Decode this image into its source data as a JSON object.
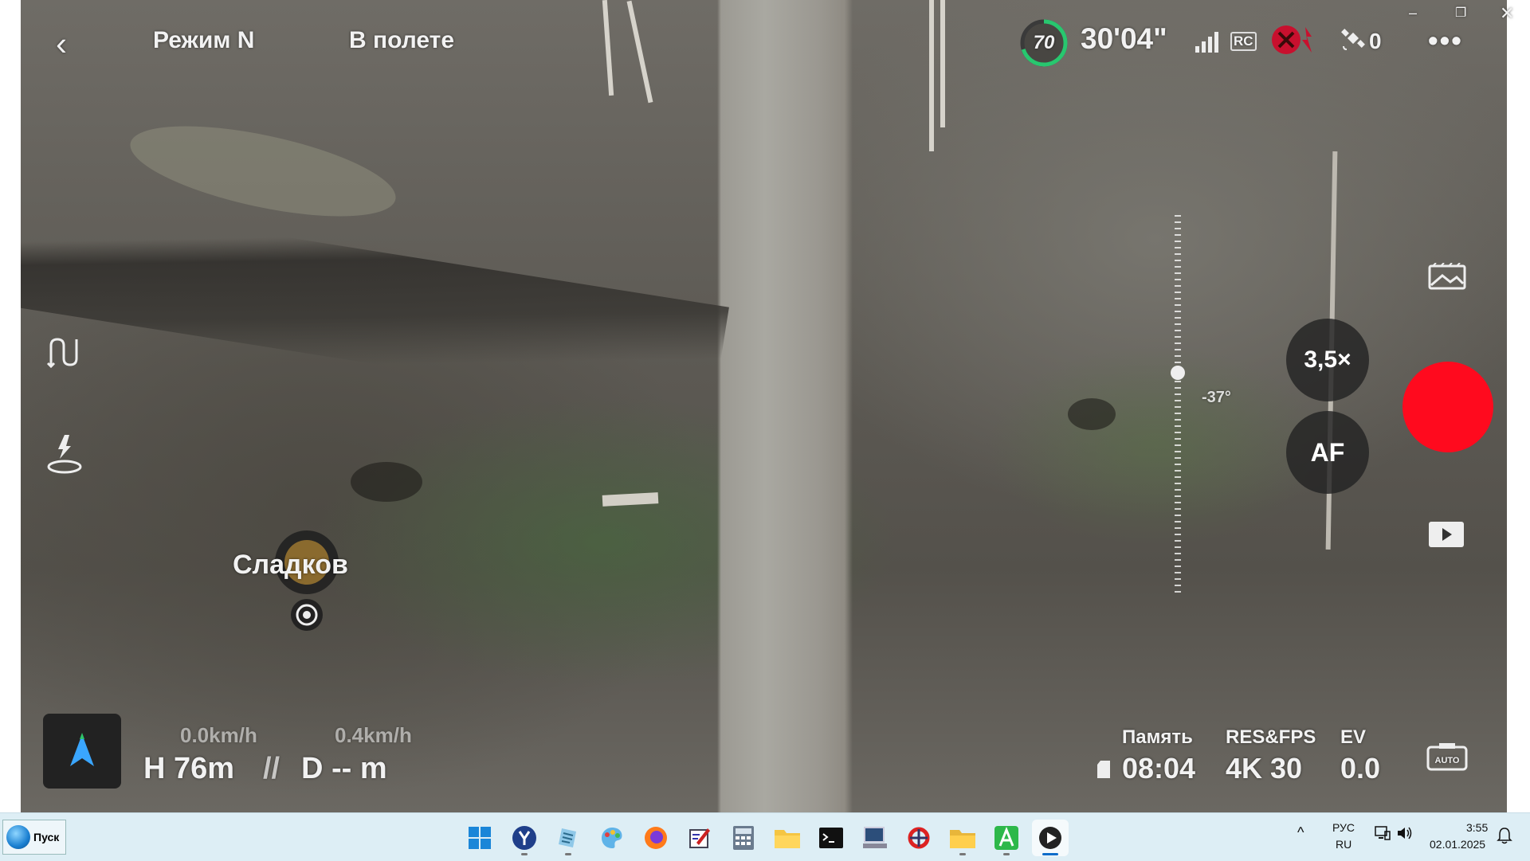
{
  "app": {
    "window_controls": {
      "minimize": "–",
      "restore": "❐",
      "close": "✕"
    }
  },
  "hud": {
    "back_glyph": "‹",
    "mode_label": "Режим N",
    "flight_status": "В полете",
    "battery_percent": "70",
    "flight_time": "30'04\"",
    "rc_label": "RC",
    "satellite_count": "0",
    "more_glyph": "•••",
    "target_label": "Сладков",
    "zoom_label": "3,5×",
    "focus_label": "AF",
    "gimbal_angle": "-37°",
    "horizontal_speed": "0.0km/h",
    "vertical_speed": "0.4km/h",
    "altitude": "H 76m",
    "altitude_sep": "//",
    "distance": "D -- m",
    "memory_label": "Память",
    "memory_value": "08:04",
    "resfps_label": "RES&FPS",
    "resfps_value": "4K 30",
    "ev_label": "EV",
    "ev_value": "0.0",
    "colors": {
      "record": "#ff0a1e",
      "battery_ring": "#28c76f"
    }
  },
  "taskbar": {
    "start_label": "Пуск",
    "apps": [
      {
        "name": "windows-start",
        "icon": "windows-logo-icon"
      },
      {
        "name": "yandex-browser",
        "icon": "yandex-icon"
      },
      {
        "name": "notes",
        "icon": "notepad-icon"
      },
      {
        "name": "paint",
        "icon": "paint-icon"
      },
      {
        "name": "firefox",
        "icon": "firefox-icon"
      },
      {
        "name": "editor",
        "icon": "pen-document-icon"
      },
      {
        "name": "calculator",
        "icon": "calculator-icon"
      },
      {
        "name": "explorer",
        "icon": "folder-icon"
      },
      {
        "name": "terminal",
        "icon": "terminal-icon"
      },
      {
        "name": "remote-desktop",
        "icon": "computer-icon"
      },
      {
        "name": "network-tool",
        "icon": "network-icon"
      },
      {
        "name": "explorer-2",
        "icon": "folder-icon"
      },
      {
        "name": "app-a",
        "icon": "green-a-icon"
      },
      {
        "name": "media-player",
        "icon": "play-icon"
      }
    ],
    "lang_line1": "РУС",
    "lang_line2": "RU",
    "tray_chevron": "^",
    "time": "3:55",
    "date": "02.01.2025"
  }
}
